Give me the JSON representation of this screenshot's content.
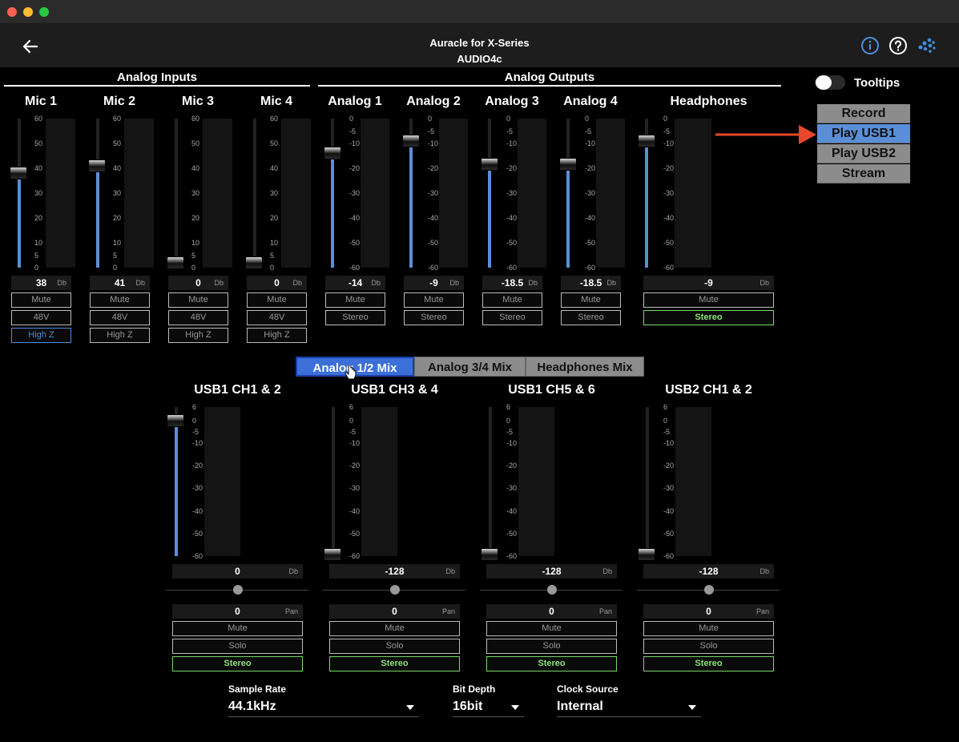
{
  "app": {
    "title_line1": "Auracle for X-Series",
    "title_line2": "AUDIO4c"
  },
  "sections": {
    "analog_inputs": "Analog Inputs",
    "analog_outputs": "Analog Outputs"
  },
  "tooltips": {
    "label": "Tooltips",
    "enabled": false
  },
  "routing": {
    "options": [
      "Record",
      "Play USB1",
      "Play USB2",
      "Stream"
    ],
    "selected": "Play USB1"
  },
  "scales": {
    "input": [
      "60",
      "50",
      "40",
      "30",
      "20",
      "10",
      "5",
      "0"
    ],
    "output": [
      "0",
      "-5",
      "-10",
      "-20",
      "-30",
      "-40",
      "-50",
      "-60"
    ],
    "mix": [
      "6",
      "0",
      "-5",
      "-10",
      "-20",
      "-30",
      "-40",
      "-50",
      "-60"
    ]
  },
  "units": {
    "db": "Db",
    "pan": "Pan"
  },
  "inputs": [
    {
      "label": "Mic 1",
      "value": "38",
      "level": 38,
      "mute": "Mute",
      "phantom": "48V",
      "highz": "High Z",
      "highz_active": true
    },
    {
      "label": "Mic 2",
      "value": "41",
      "level": 41,
      "mute": "Mute",
      "phantom": "48V",
      "highz": "High Z",
      "highz_active": false
    },
    {
      "label": "Mic 3",
      "value": "0",
      "level": 0,
      "mute": "Mute",
      "phantom": "48V",
      "highz": "High Z",
      "highz_active": false
    },
    {
      "label": "Mic 4",
      "value": "0",
      "level": 0,
      "mute": "Mute",
      "phantom": "48V",
      "highz": "High Z",
      "highz_active": false
    }
  ],
  "outputs": [
    {
      "label": "Analog 1",
      "value": "-14",
      "level": -14,
      "mute": "Mute",
      "stereo": "Stereo",
      "stereo_active": false
    },
    {
      "label": "Analog 2",
      "value": "-9",
      "level": -9,
      "mute": "Mute",
      "stereo": "Stereo",
      "stereo_active": false
    },
    {
      "label": "Analog 3",
      "value": "-18.5",
      "level": -18.5,
      "mute": "Mute",
      "stereo": "Stereo",
      "stereo_active": false
    },
    {
      "label": "Analog 4",
      "value": "-18.5",
      "level": -18.5,
      "mute": "Mute",
      "stereo": "Stereo",
      "stereo_active": false
    }
  ],
  "headphones": {
    "label": "Headphones",
    "value": "-9",
    "level": -9,
    "mute": "Mute",
    "stereo": "Stereo",
    "stereo_active": true
  },
  "mix_tabs": {
    "items": [
      "Analog 1/2 Mix",
      "Analog 3/4 Mix",
      "Headphones Mix"
    ],
    "selected": "Analog 1/2 Mix"
  },
  "mix_channels": [
    {
      "label": "USB1 CH1 & 2",
      "value": "0",
      "level": 0,
      "pan": "0",
      "mute": "Mute",
      "solo": "Solo",
      "stereo": "Stereo"
    },
    {
      "label": "USB1 CH3 & 4",
      "value": "-128",
      "level": -128,
      "pan": "0",
      "mute": "Mute",
      "solo": "Solo",
      "stereo": "Stereo"
    },
    {
      "label": "USB1 CH5 & 6",
      "value": "-128",
      "level": -128,
      "pan": "0",
      "mute": "Mute",
      "solo": "Solo",
      "stereo": "Stereo"
    },
    {
      "label": "USB2 CH1 & 2",
      "value": "-128",
      "level": -128,
      "pan": "0",
      "mute": "Mute",
      "solo": "Solo",
      "stereo": "Stereo"
    }
  ],
  "settings": {
    "sample_rate": {
      "label": "Sample Rate",
      "value": "44.1kHz"
    },
    "bit_depth": {
      "label": "Bit Depth",
      "value": "16bit"
    },
    "clock_source": {
      "label": "Clock Source",
      "value": "Internal"
    }
  },
  "colors": {
    "accent_blue": "#5a8fd8",
    "stereo_green": "#8ee07a",
    "arrow_red": "#e8472a"
  }
}
